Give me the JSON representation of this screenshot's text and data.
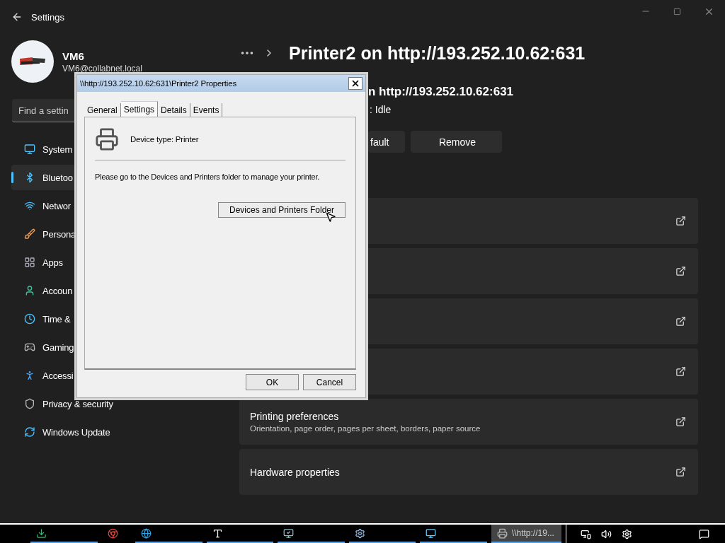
{
  "settings_window": {
    "title": "Settings",
    "user": {
      "name": "VM6",
      "email": "VM6@collabnet.local"
    },
    "search": {
      "placeholder": "Find a settin"
    },
    "sidebar": {
      "items": [
        {
          "label": "System",
          "selected": false
        },
        {
          "label": "Bluetoo",
          "selected": true
        },
        {
          "label": "Networ",
          "selected": false
        },
        {
          "label": "Persona",
          "selected": false
        },
        {
          "label": "Apps",
          "selected": false
        },
        {
          "label": "Accoun",
          "selected": false
        },
        {
          "label": "Time &",
          "selected": false
        },
        {
          "label": "Gaming",
          "selected": false
        },
        {
          "label": "Accessi",
          "selected": false
        },
        {
          "label": "Privacy & security",
          "selected": false
        },
        {
          "label": "Windows Update",
          "selected": false
        }
      ]
    },
    "page_title": "Printer2 on http://193.252.10.62:631",
    "printer_header": {
      "name": "n http://193.252.10.62:631",
      "status": ":  Idle"
    },
    "actions": [
      {
        "label": "fault"
      },
      {
        "label": "Remove"
      }
    ],
    "cards": [
      {
        "kind": "link"
      },
      {
        "kind": "link"
      },
      {
        "kind": "link"
      },
      {
        "kind": "link"
      },
      {
        "kind": "link",
        "title": "Printing preferences",
        "description": "Orientation, page order, pages per sheet, borders, paper source"
      },
      {
        "kind": "link",
        "title": "Hardware properties"
      }
    ]
  },
  "dialog": {
    "title": "\\\\http://193.252.10.62:631\\Printer2 Properties",
    "tabs": [
      {
        "label": "General",
        "selected": false
      },
      {
        "label": "Settings",
        "selected": true
      },
      {
        "label": "Details",
        "selected": false
      },
      {
        "label": "Events",
        "selected": false
      }
    ],
    "device_type": "Device type: Printer",
    "message": "Please go to the Devices and Printers folder to manage your printer.",
    "folder_button": "Devices and Printers Folder",
    "buttons": [
      "OK",
      "Cancel"
    ]
  },
  "taskbar": {
    "items": [
      {
        "kind": "download",
        "running": true,
        "selected": false
      },
      {
        "kind": "browser",
        "running": false,
        "selected": false
      },
      {
        "kind": "edge",
        "running": true,
        "selected": false
      },
      {
        "kind": "fonts",
        "running": true,
        "selected": false
      },
      {
        "kind": "remote",
        "running": true,
        "selected": false
      },
      {
        "kind": "settings",
        "running": true,
        "selected": false
      },
      {
        "kind": "monitor",
        "running": true,
        "selected": false
      },
      {
        "kind": "window",
        "label": "\\\\http://19...",
        "running": true,
        "selected": true
      }
    ]
  }
}
